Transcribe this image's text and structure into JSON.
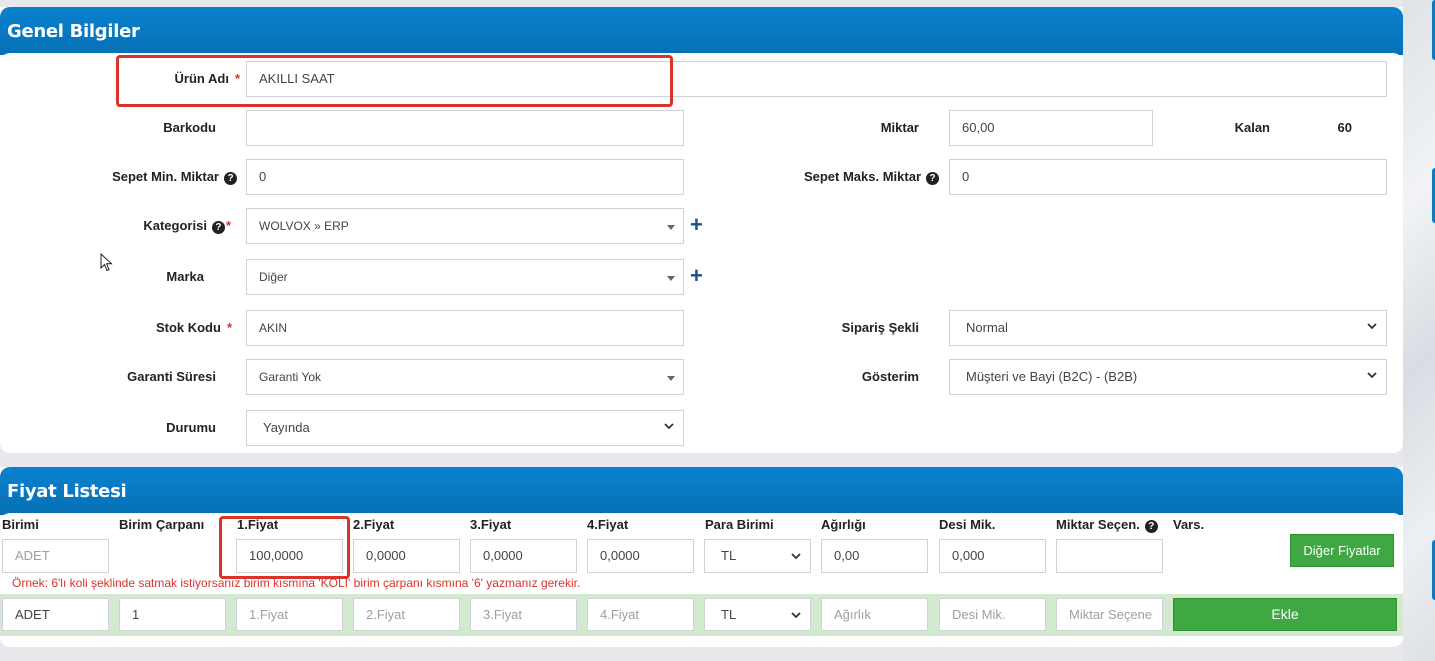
{
  "general": {
    "title": "Genel Bilgiler",
    "urun_adi": {
      "label": "Ürün Adı",
      "value": "AKILLI SAAT"
    },
    "barkodu": {
      "label": "Barkodu",
      "value": ""
    },
    "miktar": {
      "label": "Miktar",
      "value": "60,00"
    },
    "kalan": {
      "label": "Kalan",
      "value": "60"
    },
    "sepet_min": {
      "label": "Sepet Min. Miktar",
      "value": "0"
    },
    "sepet_maks": {
      "label": "Sepet Maks. Miktar",
      "value": "0"
    },
    "kategori": {
      "label": "Kategorisi",
      "value": "WOLVOX » ERP"
    },
    "marka": {
      "label": "Marka",
      "value": "Diğer"
    },
    "stok_kodu": {
      "label": "Stok Kodu",
      "value": "AKIN"
    },
    "siparis_sekli": {
      "label": "Sipariş Şekli",
      "value": "Normal"
    },
    "garanti": {
      "label": "Garanti Süresi",
      "value": "Garanti Yok"
    },
    "gosterim": {
      "label": "Gösterim",
      "value": "Müşteri ve Bayi (B2C) - (B2B)"
    },
    "durumu": {
      "label": "Durumu",
      "value": "Yayında"
    },
    "required_mark": "*",
    "help_mark": "?",
    "plus_mark": "+"
  },
  "price": {
    "title": "Fiyat Listesi",
    "headers": {
      "birimi": "Birimi",
      "carpan": "Birim Çarpanı",
      "f1": "1.Fiyat",
      "f2": "2.Fiyat",
      "f3": "3.Fiyat",
      "f4": "4.Fiyat",
      "para": "Para Birimi",
      "agirlik": "Ağırlığı",
      "desi": "Desi Mik.",
      "miktar_secen": "Miktar Seçen.",
      "vars": "Vars."
    },
    "row": {
      "birimi": "ADET",
      "f1": "100,0000",
      "f2": "0,0000",
      "f3": "0,0000",
      "f4": "0,0000",
      "para": "TL",
      "agirlik": "0,00",
      "desi": "0,000",
      "miktar_secen": ""
    },
    "other_prices_button": "Diğer Fiyatlar",
    "note": "Örnek: 6'lı koli şeklinde satmak istiyorsanız birim kısmına 'KOLİ' birim çarpanı kısmına '6' yazmanız gerekir.",
    "new_row": {
      "birimi": "ADET",
      "carpan": "1",
      "f1_placeholder": "1.Fiyat",
      "f2_placeholder": "2.Fiyat",
      "f3_placeholder": "3.Fiyat",
      "f4_placeholder": "4.Fiyat",
      "para": "TL",
      "agirlik_placeholder": "Ağırlık",
      "desi_placeholder": "Desi Mik.",
      "miktar_placeholder": "Miktar Seçene",
      "add_button": "Ekle"
    }
  },
  "colors": {
    "header_blue": "#0670b5",
    "required_red": "#d9342b",
    "button_green": "#3fa843",
    "row_green": "#d3ead0"
  }
}
